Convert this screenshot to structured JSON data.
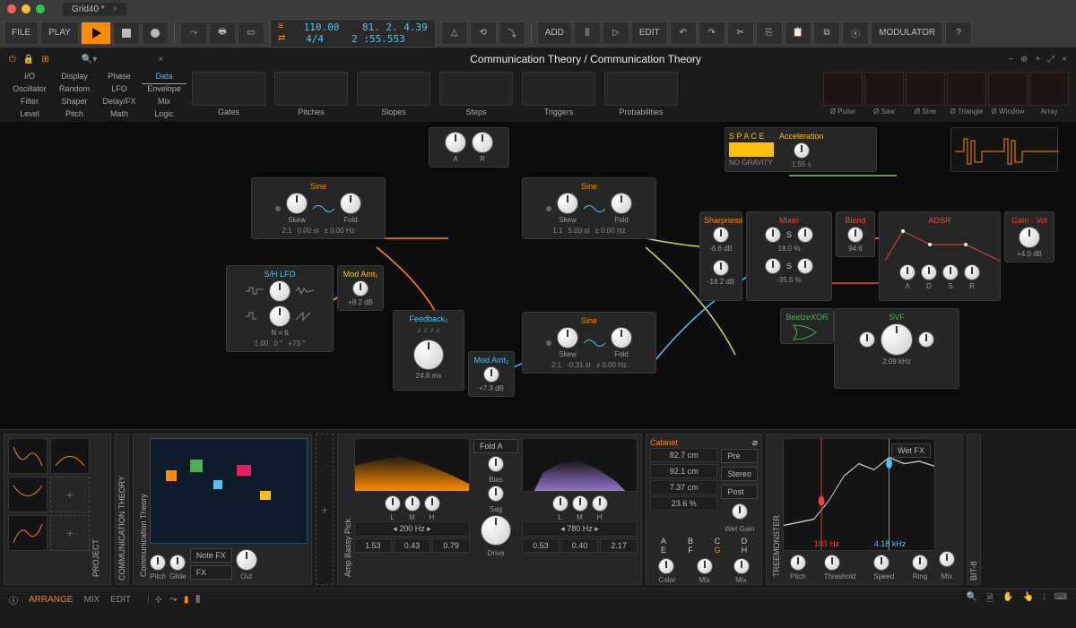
{
  "tab_name": "Grid40 *",
  "toolbar": {
    "file": "FILE",
    "play": "PLAY",
    "add": "ADD",
    "edit": "EDIT",
    "modulator": "MODULATOR"
  },
  "transport": {
    "tempo": "110.00",
    "sig": "4/4",
    "position": "81. 2. 4.39",
    "time": "2 :55.553"
  },
  "breadcrumb": "Communication Theory / Communication Theory",
  "cat_labels": [
    "I/O",
    "Display",
    "Phase",
    "Data",
    "Oscillator",
    "Random",
    "LFO",
    "Envelope",
    "Filter",
    "Shaper",
    "Delay/FX",
    "Mix",
    "Level",
    "Pitch",
    "Math",
    "Logic"
  ],
  "cat_previews": [
    "Gates",
    "Pitches",
    "Slopes",
    "Steps",
    "Triggers",
    "Probabilities"
  ],
  "pulses": [
    "Ø Pulse",
    "Ø Saw",
    "Ø Sine",
    "Ø Triangle",
    "Ø Window",
    "Array"
  ],
  "modules": {
    "ar": {
      "k1": "A",
      "k2": "R"
    },
    "sine1": {
      "title": "Sine",
      "k1": "Skew",
      "k2": "Fold",
      "f": [
        "2:1",
        "0.00 st",
        "± 0.00 Hz"
      ]
    },
    "sine2": {
      "title": "Sine",
      "k1": "Skew",
      "k2": "Fold",
      "f": [
        "1:1",
        "5.00 st",
        "± 0.00 Hz"
      ]
    },
    "sine3": {
      "title": "Sine",
      "k1": "Skew",
      "k2": "Fold",
      "f": [
        "2:1",
        "-0.31 st",
        "± 0.00 Hz"
      ]
    },
    "shlfo": {
      "title": "S/H LFO",
      "n": "N = 6",
      "f": [
        "1.00",
        "0 °",
        "+73 °"
      ]
    },
    "modamt1": {
      "title": "Mod Amt₁",
      "v": "+8.2 dB"
    },
    "modamt2": {
      "title": "Mod Amt₂",
      "v": "+7.3 dB"
    },
    "feedback": {
      "title": "Feedback₂",
      "v": "24.8 ms"
    },
    "space": {
      "title": "S P A C E",
      "sub": "NO GRAVITY",
      "accel": "Acceleration",
      "accel_v": "1.55 s"
    },
    "sharpness": {
      "title": "Sharpness",
      "v": "-6.6 dB",
      "v2": "-18.2 dB"
    },
    "mixer": {
      "title": "Mixer",
      "v": "S",
      "v2": "18.0 %",
      "v3": "S",
      "v4": "-35.5 %"
    },
    "blend": {
      "title": "Blend",
      "v": "94:6"
    },
    "adsr": {
      "title": "ADSR",
      "a": "A",
      "d": "D",
      "s": "S",
      "r": "R"
    },
    "gain": {
      "title": "Gain - Vol",
      "v": "+4.0 dB"
    },
    "beelzexor": {
      "title": "BeelzeXOR"
    },
    "svf": {
      "title": "SVF",
      "v": "2.09 kHz"
    }
  },
  "devices": {
    "project": "PROJECT",
    "commtheory": "COMMUNICATION THEORY",
    "commtheory2": "Communication Theory",
    "note_fx": "Note FX",
    "fx": "FX",
    "pitch": "Pitch",
    "glide": "Glide",
    "out": "Out",
    "amp": "Amp Bassy Pick",
    "fold_a": "Fold A",
    "bias": "Bias",
    "sag": "Sag",
    "drive": "Drive",
    "lmh": [
      "L",
      "M",
      "H"
    ],
    "freq1": "200 Hz",
    "vals1": [
      "1.53",
      "0.43",
      "0.79"
    ],
    "freq2": "780 Hz",
    "vals2": [
      "0.53",
      "0.40",
      "2.17"
    ],
    "cabinet": "Cabinet",
    "pre": "Pre",
    "stereo": "Stereo",
    "post": "Post",
    "dims": [
      "82.7 cm",
      "92.1 cm",
      "7.37 cm",
      "23.6 %"
    ],
    "wet_gain": "Wet Gain",
    "letters": [
      "A",
      "B",
      "C",
      "D",
      "E",
      "F",
      "G",
      "H"
    ],
    "color": "Color",
    "mix": "Mix",
    "treemonster": "TREEMONSTER",
    "hz1": "103 Hz",
    "hz2": "4.18 kHz",
    "tm_knobs": [
      "Pitch",
      "Threshold",
      "Speed",
      "Ring"
    ],
    "wet_fx": "Wet FX",
    "bit8": "BIT-8"
  },
  "footer": {
    "arrange": "ARRANGE",
    "mix": "MIX",
    "edit": "EDIT"
  }
}
